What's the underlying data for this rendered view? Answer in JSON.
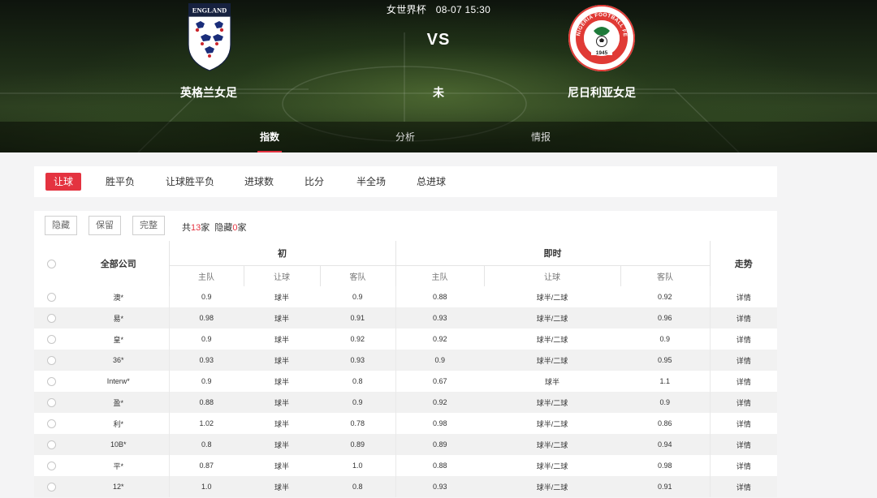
{
  "match": {
    "competition": "女世界杯",
    "datetime": "08-07 15:30",
    "vs": "VS",
    "status": "未",
    "home": {
      "name": "英格兰女足",
      "crest_text": "ENGLAND"
    },
    "away": {
      "name": "尼日利亚女足",
      "crest_text": "NIGERIA FOOTBALL FEDERATION",
      "crest_year": "1945"
    }
  },
  "nav_tabs": [
    {
      "label": "指数",
      "active": true
    },
    {
      "label": "分析",
      "active": false
    },
    {
      "label": "情报",
      "active": false
    }
  ],
  "market_tabs": [
    {
      "label": "让球",
      "active": true
    },
    {
      "label": "胜平负",
      "active": false
    },
    {
      "label": "让球胜平负",
      "active": false
    },
    {
      "label": "进球数",
      "active": false
    },
    {
      "label": "比分",
      "active": false
    },
    {
      "label": "半全场",
      "active": false
    },
    {
      "label": "总进球",
      "active": false
    }
  ],
  "toolbar": {
    "hide_label": "隐藏",
    "keep_label": "保留",
    "full_label": "完整",
    "total_prefix": "共",
    "total_count": "13",
    "unit": "家",
    "hidden_prefix": "隐藏",
    "hidden_count": "0"
  },
  "table": {
    "company_header": "全部公司",
    "initial_header": "初",
    "live_header": "即时",
    "trend_header": "走势",
    "sub_headers": {
      "home": "主队",
      "handicap": "让球",
      "away": "客队"
    },
    "rows": [
      {
        "company": "澳*",
        "init_home": "0.9",
        "init_line": "球半",
        "init_away": "0.9",
        "live_home": "0.88",
        "live_line": "球半/二球",
        "live_away": "0.92",
        "detail": "详情"
      },
      {
        "company": "易*",
        "init_home": "0.98",
        "init_line": "球半",
        "init_away": "0.91",
        "live_home": "0.93",
        "live_line": "球半/二球",
        "live_away": "0.96",
        "detail": "详情"
      },
      {
        "company": "皇*",
        "init_home": "0.9",
        "init_line": "球半",
        "init_away": "0.92",
        "live_home": "0.92",
        "live_line": "球半/二球",
        "live_away": "0.9",
        "detail": "详情"
      },
      {
        "company": "36*",
        "init_home": "0.93",
        "init_line": "球半",
        "init_away": "0.93",
        "live_home": "0.9",
        "live_line": "球半/二球",
        "live_away": "0.95",
        "detail": "详情"
      },
      {
        "company": "Interw*",
        "init_home": "0.9",
        "init_line": "球半",
        "init_away": "0.8",
        "live_home": "0.67",
        "live_line": "球半",
        "live_away": "1.1",
        "detail": "详情"
      },
      {
        "company": "盈*",
        "init_home": "0.88",
        "init_line": "球半",
        "init_away": "0.9",
        "live_home": "0.92",
        "live_line": "球半/二球",
        "live_away": "0.9",
        "detail": "详情"
      },
      {
        "company": "利*",
        "init_home": "1.02",
        "init_line": "球半",
        "init_away": "0.78",
        "live_home": "0.98",
        "live_line": "球半/二球",
        "live_away": "0.86",
        "detail": "详情"
      },
      {
        "company": "10B*",
        "init_home": "0.8",
        "init_line": "球半",
        "init_away": "0.89",
        "live_home": "0.89",
        "live_line": "球半/二球",
        "live_away": "0.94",
        "detail": "详情"
      },
      {
        "company": "平*",
        "init_home": "0.87",
        "init_line": "球半",
        "init_away": "1.0",
        "live_home": "0.88",
        "live_line": "球半/二球",
        "live_away": "0.98",
        "detail": "详情"
      },
      {
        "company": "12*",
        "init_home": "1.0",
        "init_line": "球半",
        "init_away": "0.8",
        "live_home": "0.93",
        "live_line": "球半/二球",
        "live_away": "0.91",
        "detail": "详情"
      }
    ]
  },
  "colors": {
    "accent": "#e43340",
    "row_alt": "#f1f1f1"
  }
}
